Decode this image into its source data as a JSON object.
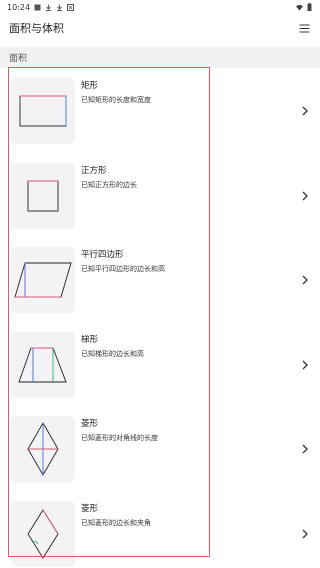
{
  "status_bar": {
    "time": "10:24",
    "left_icons": [
      "image-icon",
      "download-icon",
      "download-icon",
      "app-icon"
    ],
    "right_icons": [
      "wifi-icon",
      "battery-icon"
    ]
  },
  "app_bar": {
    "title": "面积与体积",
    "menu_icon": "hamburger-menu-icon"
  },
  "section": {
    "title": "面积"
  },
  "items": [
    {
      "title": "矩形",
      "subtitle": "已知矩形的长度和宽度",
      "icon": "rectangle-diagram"
    },
    {
      "title": "正方形",
      "subtitle": "已知正方形的边长",
      "icon": "square-diagram"
    },
    {
      "title": "平行四边形",
      "subtitle": "已知平行四边形的边长和高",
      "icon": "parallelogram-diagram"
    },
    {
      "title": "梯形",
      "subtitle": "已知梯形的边长和高",
      "icon": "trapezoid-diagram"
    },
    {
      "title": "菱形",
      "subtitle": "已知菱形的对角线的长度",
      "icon": "rhombus-diagonals-diagram"
    },
    {
      "title": "菱形",
      "subtitle": "已知菱形的边长和夹角",
      "icon": "rhombus-angle-diagram"
    }
  ],
  "colors": {
    "highlight_frame": "#e05b5b",
    "section_bg": "#f1f1f3",
    "thumb_bg": "#f3f3f5",
    "diagram_red": "#e0556a",
    "diagram_blue": "#5a7bd8",
    "diagram_green": "#3fb97a"
  }
}
